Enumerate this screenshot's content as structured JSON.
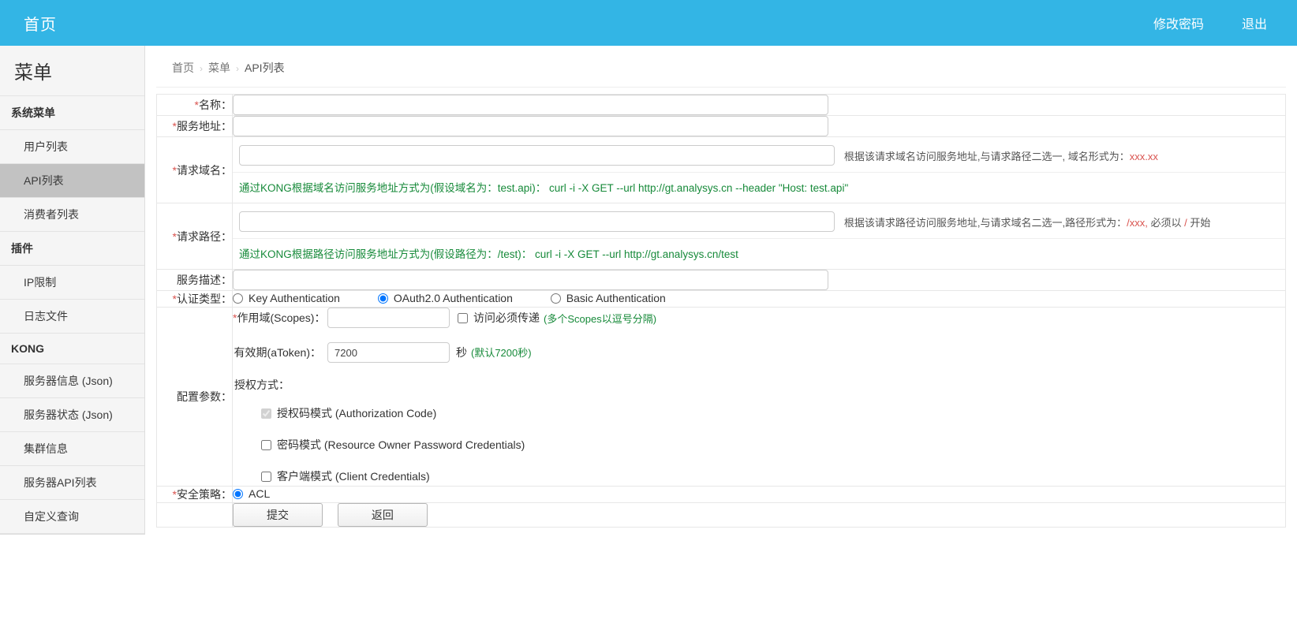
{
  "topbar": {
    "brand": "首页",
    "change_password": "修改密码",
    "logout": "退出"
  },
  "sidebar": {
    "title": "菜单",
    "items": [
      {
        "label": "系统菜单",
        "type": "header",
        "active": false
      },
      {
        "label": "用户列表",
        "type": "child",
        "active": false
      },
      {
        "label": "API列表",
        "type": "child",
        "active": true
      },
      {
        "label": "消费者列表",
        "type": "child",
        "active": false
      },
      {
        "label": "插件",
        "type": "header",
        "active": false
      },
      {
        "label": "IP限制",
        "type": "child",
        "active": false
      },
      {
        "label": "日志文件",
        "type": "child",
        "active": false
      },
      {
        "label": "KONG",
        "type": "header",
        "active": false
      },
      {
        "label": "服务器信息 (Json)",
        "type": "child",
        "active": false
      },
      {
        "label": "服务器状态 (Json)",
        "type": "child",
        "active": false
      },
      {
        "label": "集群信息",
        "type": "child",
        "active": false
      },
      {
        "label": "服务器API列表",
        "type": "child",
        "active": false
      },
      {
        "label": "自定义查询",
        "type": "child",
        "active": false
      }
    ]
  },
  "breadcrumb": {
    "home": "首页",
    "menu": "菜单",
    "current": "API列表",
    "separator": "›"
  },
  "form": {
    "name": {
      "label": "名称：",
      "required": true,
      "value": ""
    },
    "service_url": {
      "label": "服务地址：",
      "required": true,
      "value": ""
    },
    "request_host": {
      "label": "请求域名：",
      "required": true,
      "value": "",
      "hint_prefix": "根据该请求域名访问服务地址,与请求路径二选一, 域名形式为：",
      "hint_red": "xxx.xx",
      "example": "通过KONG根据域名访问服务地址方式为(假设域名为：test.api)： curl -i -X GET --url http://gt.analysys.cn --header \"Host: test.api\""
    },
    "request_path": {
      "label": "请求路径：",
      "required": true,
      "value": "",
      "hint_prefix": "根据该请求路径访问服务地址,与请求域名二选一,路径形式为：",
      "hint_red": "/xxx,",
      "hint_mid": " 必须以 ",
      "hint_red2": "/",
      "hint_suffix": " 开始",
      "example": "通过KONG根据路径访问服务地址方式为(假设路径为：/test)： curl -i -X GET --url http://gt.analysys.cn/test"
    },
    "description": {
      "label": "服务描述：",
      "required": false,
      "value": ""
    },
    "auth_type": {
      "label": "认证类型：",
      "required": true,
      "options": [
        {
          "label": "Key Authentication",
          "checked": false
        },
        {
          "label": "OAuth2.0 Authentication",
          "checked": true
        },
        {
          "label": "Basic Authentication",
          "checked": false
        }
      ]
    },
    "config": {
      "label": "配置参数：",
      "required": false,
      "scopes": {
        "label": "作用域(Scopes)：",
        "required": true,
        "value": "",
        "checkbox_label": "访问必须传递",
        "checkbox_checked": false,
        "hint": "(多个Scopes以逗号分隔)"
      },
      "token": {
        "label": "有效期(aToken)：",
        "value": "7200",
        "unit": "秒",
        "hint": "(默认7200秒)"
      },
      "grant_title": "授权方式：",
      "grants": [
        {
          "label": "授权码模式 (Authorization Code)",
          "checked": true,
          "disabled": true
        },
        {
          "label": "密码模式 (Resource Owner Password Credentials)",
          "checked": false,
          "disabled": false
        },
        {
          "label": "客户端模式 (Client Credentials)",
          "checked": false,
          "disabled": false
        }
      ]
    },
    "security": {
      "label": "安全策略：",
      "required": true,
      "options": [
        {
          "label": "ACL",
          "checked": true
        }
      ]
    },
    "actions": {
      "submit": "提交",
      "back": "返回"
    }
  },
  "colors": {
    "accent": "#33b5e5",
    "required": "#d9534f",
    "hint_green": "#178a3a",
    "active_item": "#c2c2c2"
  }
}
